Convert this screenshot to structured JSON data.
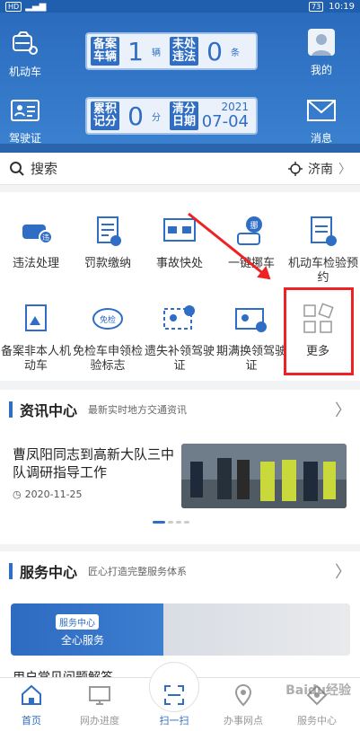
{
  "status_bar": {
    "left": "HD",
    "time": "10:19",
    "battery": "73"
  },
  "header": {
    "vehicle_label": "机动车",
    "license_label": "驾驶证",
    "mine_label": "我的",
    "message_label": "消息",
    "panel1": {
      "label1": "备案车辆",
      "value1": "1",
      "unit1": "辆",
      "label2": "未处违法",
      "value2": "0",
      "unit2": "条"
    },
    "panel2": {
      "label1": "累积记分",
      "value1": "0",
      "unit1": "分",
      "label2": "清分日期",
      "year": "2021",
      "date": "07-04"
    }
  },
  "search": {
    "label": "搜索",
    "city": "济南"
  },
  "grid": [
    {
      "label": "违法处理"
    },
    {
      "label": "罚款缴纳"
    },
    {
      "label": "事故快处"
    },
    {
      "label": "一键挪车"
    },
    {
      "label": "机动车检验预约"
    },
    {
      "label": "备案非本人机动车"
    },
    {
      "label": "免检车申领检验标志"
    },
    {
      "label": "遗失补领驾驶证"
    },
    {
      "label": "期满换领驾驶证"
    },
    {
      "label": "更多"
    }
  ],
  "news": {
    "title": "资讯中心",
    "subtitle": "最新实时地方交通资讯",
    "headline": "曹凤阳同志到高新大队三中队调研指导工作",
    "date": "2020-11-25"
  },
  "service": {
    "title": "服务中心",
    "subtitle": "匠心打造完整服务体系",
    "card_tag": "服务中心",
    "card_text": "全心服务",
    "faq": "用户常见问题解答"
  },
  "tabs": [
    {
      "label": "首页"
    },
    {
      "label": "网办进度"
    },
    {
      "label": "扫一扫"
    },
    {
      "label": "办事网点"
    },
    {
      "label": "服务中心"
    }
  ],
  "watermark": "Baidu经验",
  "colors": {
    "brand": "#2f6ec4",
    "highlight": "#e22222"
  }
}
